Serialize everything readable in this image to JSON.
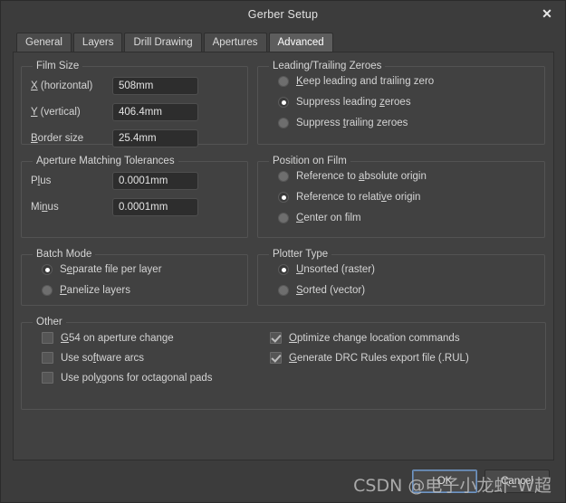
{
  "window": {
    "title": "Gerber Setup",
    "close_icon": "close-icon",
    "close_glyph": "✕"
  },
  "tabs": [
    {
      "label": "General",
      "active": false
    },
    {
      "label": "Layers",
      "active": false
    },
    {
      "label": "Drill Drawing",
      "active": false
    },
    {
      "label": "Apertures",
      "active": false
    },
    {
      "label": "Advanced",
      "active": true
    }
  ],
  "film_size": {
    "legend": "Film Size",
    "fields": [
      {
        "label_pre": "",
        "label_acc": "X",
        "label_post": " (horizontal)",
        "value": "508mm"
      },
      {
        "label_pre": "",
        "label_acc": "Y",
        "label_post": " (vertical)",
        "value": "406.4mm"
      },
      {
        "label_pre": "",
        "label_acc": "B",
        "label_post": "order size",
        "value": "25.4mm"
      }
    ]
  },
  "aperture_tolerances": {
    "legend": "Aperture Matching Tolerances",
    "fields": [
      {
        "label_pre": "P",
        "label_acc": "l",
        "label_post": "us",
        "value": "0.0001mm"
      },
      {
        "label_pre": "Mi",
        "label_acc": "n",
        "label_post": "us",
        "value": "0.0001mm"
      }
    ]
  },
  "batch_mode": {
    "legend": "Batch Mode",
    "options": [
      {
        "pre": "S",
        "acc": "e",
        "post": "parate file per layer",
        "selected": true
      },
      {
        "pre": "",
        "acc": "P",
        "post": "anelize layers",
        "selected": false
      }
    ]
  },
  "zeroes": {
    "legend": "Leading/Trailing Zeroes",
    "options": [
      {
        "pre": "",
        "acc": "K",
        "post": "eep leading and trailing zero",
        "selected": false
      },
      {
        "pre": "Suppress leading ",
        "acc": "z",
        "post": "eroes",
        "selected": true
      },
      {
        "pre": "Suppress ",
        "acc": "t",
        "post": "railing zeroes",
        "selected": false
      }
    ]
  },
  "position_on_film": {
    "legend": "Position on Film",
    "options": [
      {
        "pre": "Reference to ",
        "acc": "a",
        "post": "bsolute origin",
        "selected": false
      },
      {
        "pre": "Reference to relati",
        "acc": "v",
        "post": "e origin",
        "selected": true
      },
      {
        "pre": "",
        "acc": "C",
        "post": "enter on film",
        "selected": false
      }
    ]
  },
  "plotter_type": {
    "legend": "Plotter Type",
    "options": [
      {
        "pre": "",
        "acc": "U",
        "post": "nsorted (raster)",
        "selected": true
      },
      {
        "pre": "",
        "acc": "S",
        "post": "orted (vector)",
        "selected": false
      }
    ]
  },
  "other": {
    "legend": "Other",
    "left_checkboxes": [
      {
        "pre": "",
        "acc": "G",
        "post": "54 on aperture change",
        "checked": false
      },
      {
        "pre": "Use so",
        "acc": "f",
        "post": "tware arcs",
        "checked": false
      },
      {
        "pre": "Use pol",
        "acc": "y",
        "post": "gons for octagonal pads",
        "checked": false
      }
    ],
    "right_checkboxes": [
      {
        "pre": "",
        "acc": "O",
        "post": "ptimize change location commands",
        "checked": true
      },
      {
        "pre": "",
        "acc": "G",
        "post": "enerate DRC Rules export file (.RUL)",
        "checked": true
      }
    ]
  },
  "footer": {
    "ok_label": "OK",
    "cancel_label": "Cancel"
  },
  "watermark": {
    "text": "CSDN @电子小龙虾-W超"
  },
  "colors": {
    "dialog_bg": "#3c3c3c",
    "panel_bg": "#414141",
    "tab_active_bg": "#5d5d5d",
    "tab_bg": "#4b4b4b",
    "input_bg": "#2d2d2d",
    "text": "#d4d4d4",
    "focus_border": "#7196c4"
  }
}
